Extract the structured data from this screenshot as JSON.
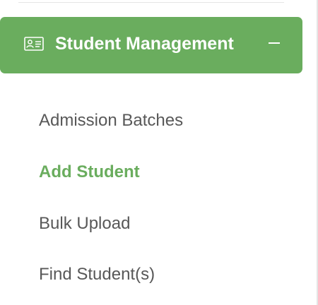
{
  "section": {
    "title": "Student Management",
    "icon": "id-card-icon",
    "toggle_icon": "minus-icon",
    "expanded": true,
    "accent_color": "#6aad5e"
  },
  "submenu": {
    "items": [
      {
        "label": "Admission Batches",
        "active": false
      },
      {
        "label": "Add Student",
        "active": true
      },
      {
        "label": "Bulk Upload",
        "active": false
      },
      {
        "label": "Find Student(s)",
        "active": false
      }
    ]
  }
}
